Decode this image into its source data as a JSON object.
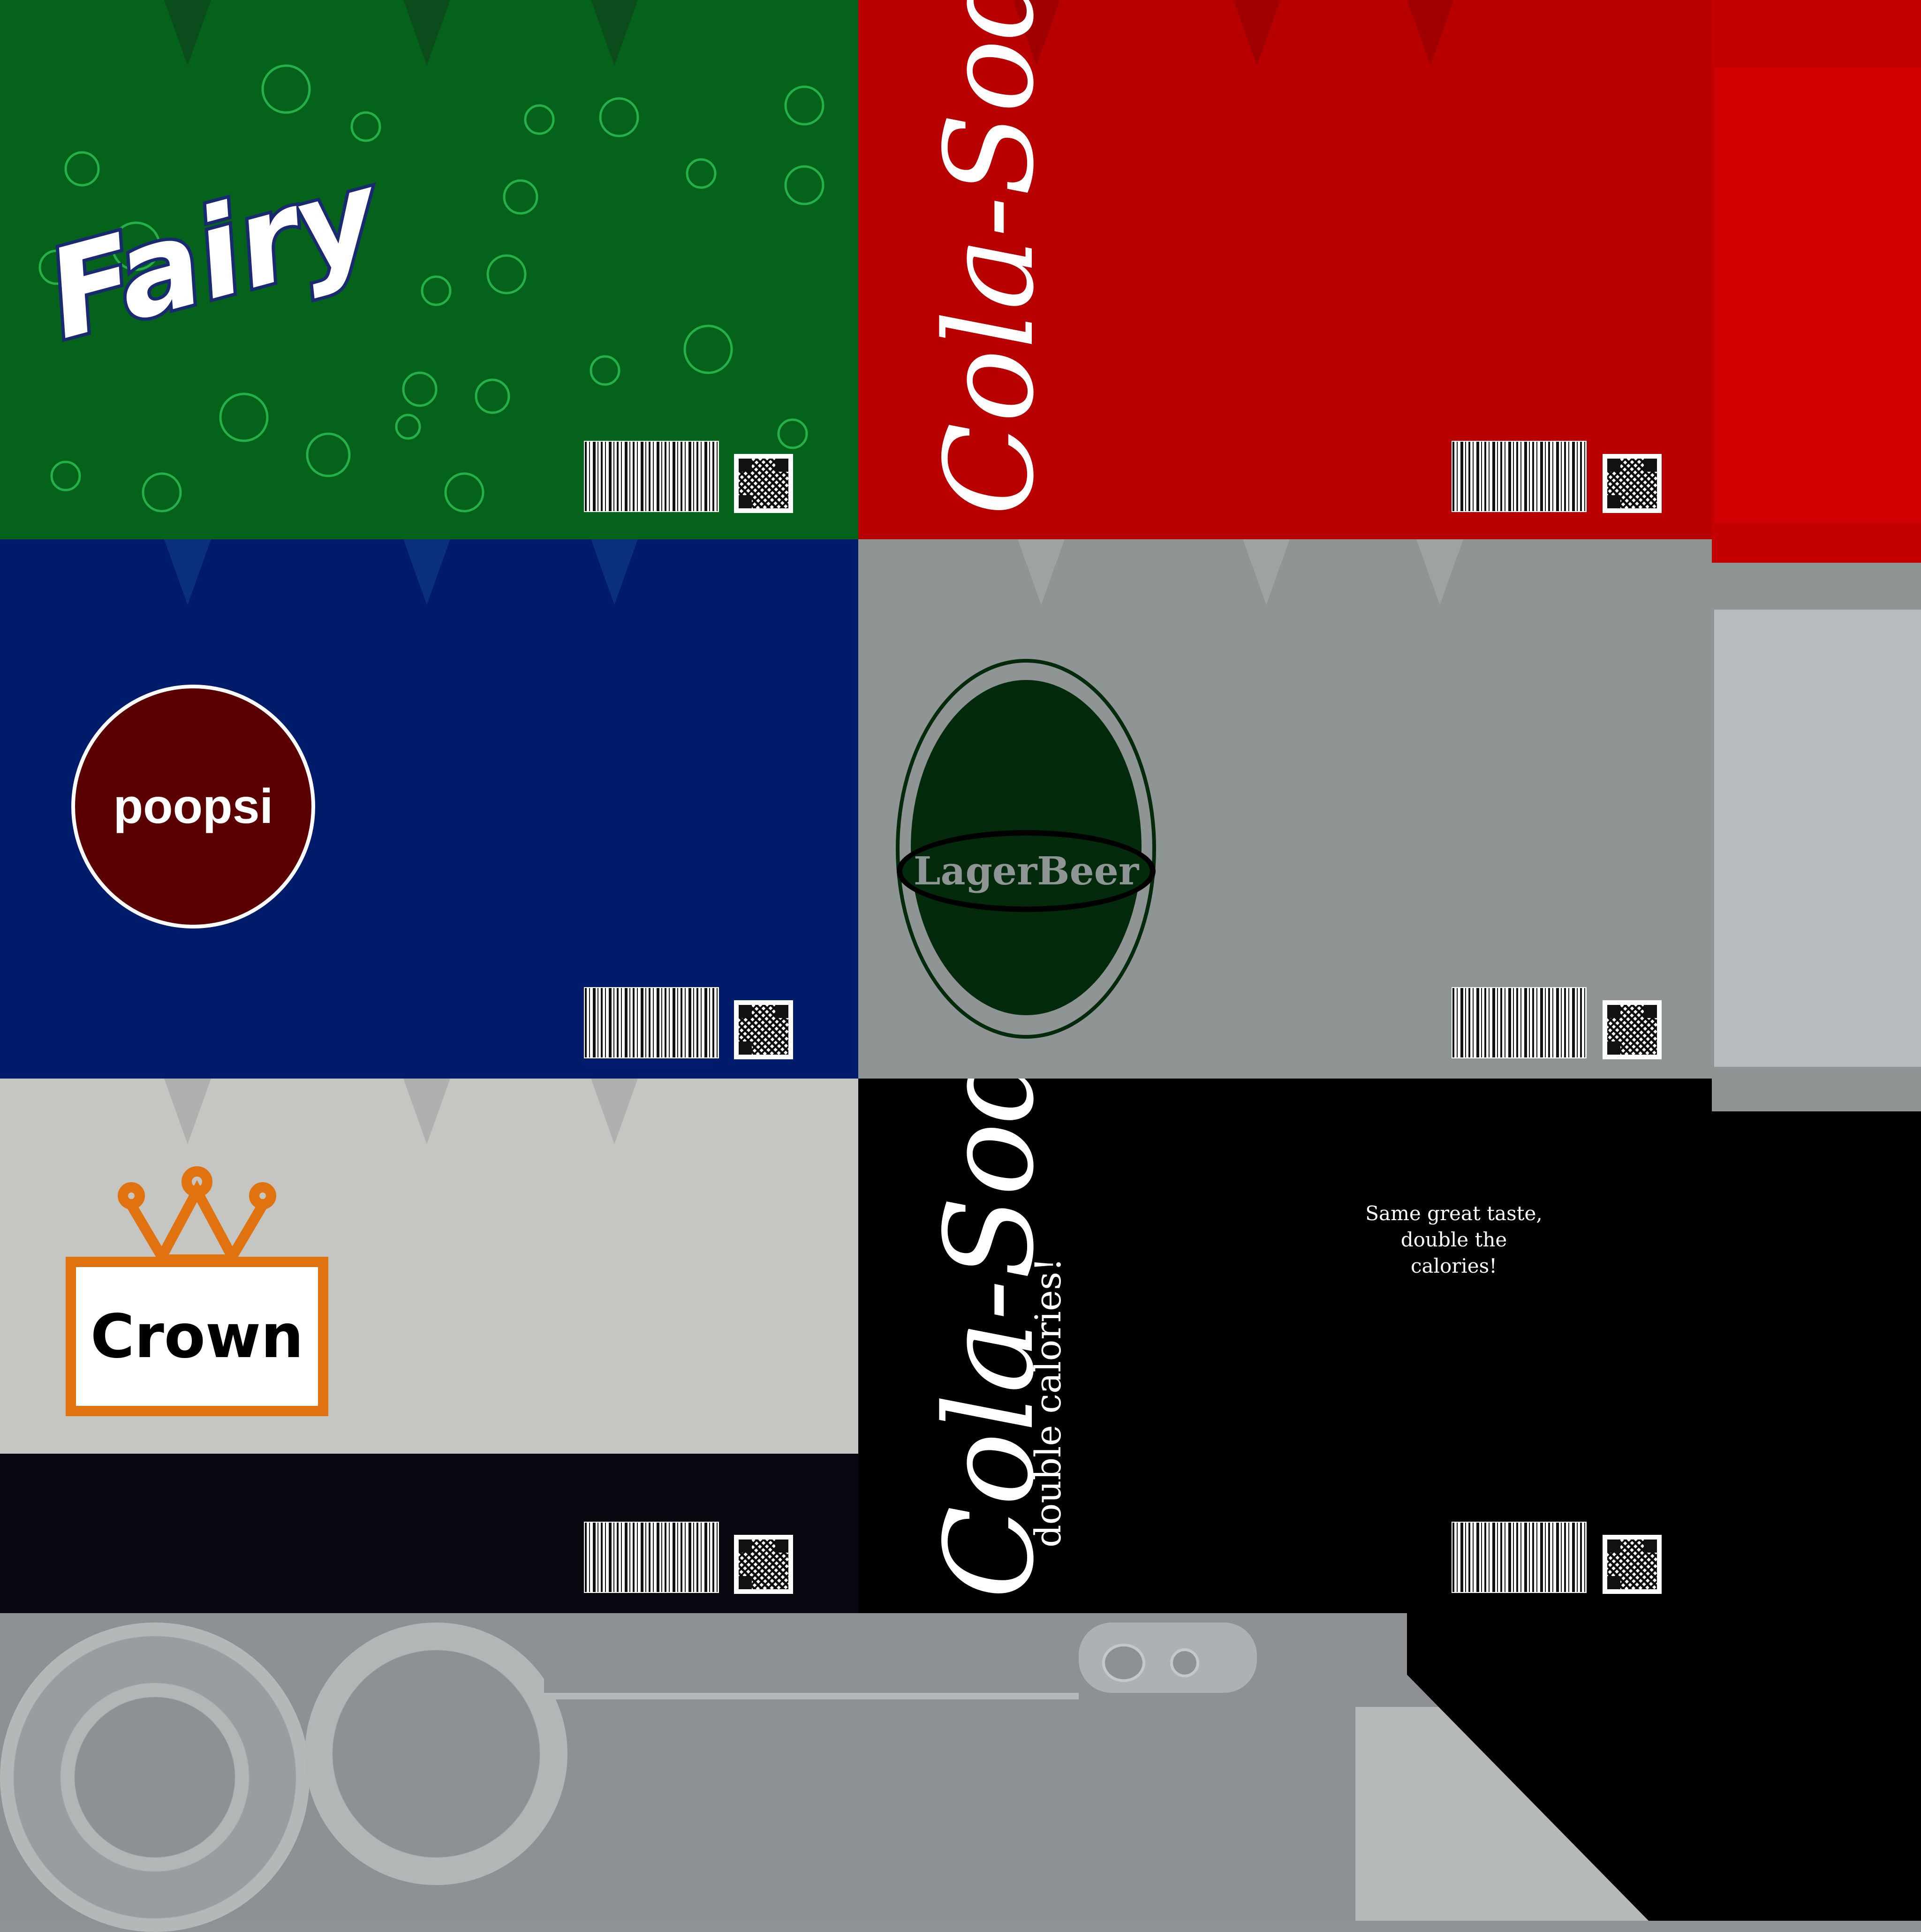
{
  "labels": {
    "fairy": {
      "brand": "Fairy",
      "bg": "#05621a"
    },
    "cola_red": {
      "brand": "Cola-Soda",
      "bg": "#b80000"
    },
    "poopsi": {
      "brand": "poopsi",
      "bg": "#001b6a",
      "badge": "#5a0000"
    },
    "lager": {
      "brand": "LagerBeer",
      "bg": "#8f9495",
      "oval": "#032b0b"
    },
    "crown": {
      "brand": "Crown",
      "bg": "#c5c5c2",
      "accent": "#e0730f"
    },
    "cola_black": {
      "brand": "Cola-Soda",
      "subtitle": "double calories!",
      "tagline_line1": "Same great taste,",
      "tagline_line2": "double the calories!",
      "bg": "#000000"
    }
  }
}
